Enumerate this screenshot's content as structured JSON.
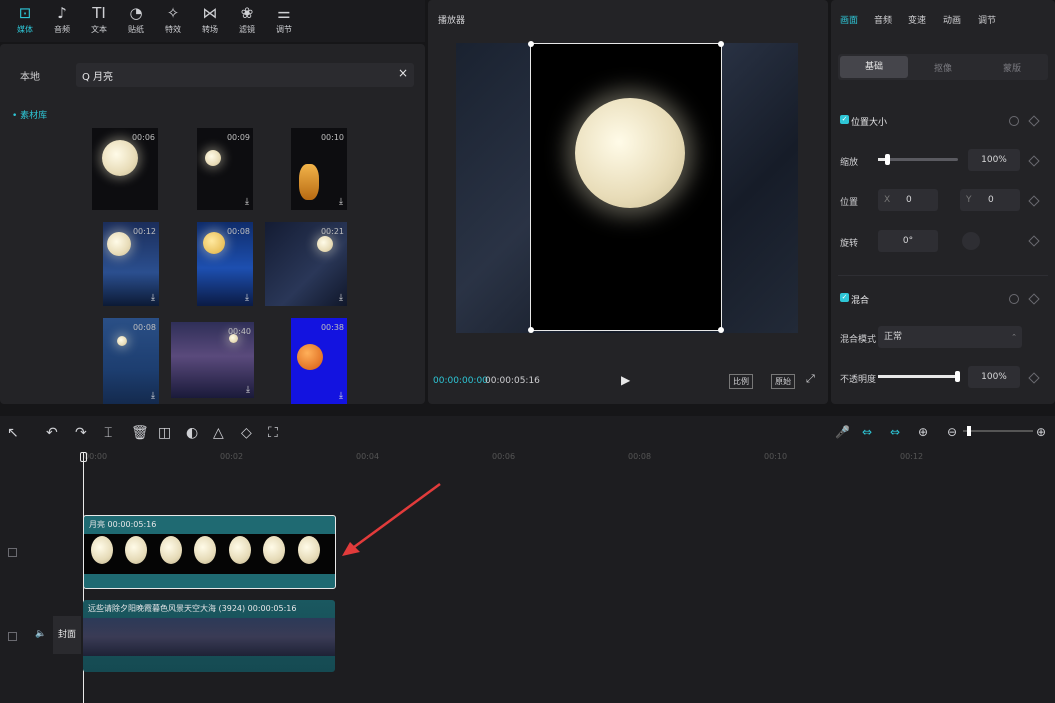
{
  "toolbar": {
    "items": [
      {
        "label": "媒体",
        "icon": "play-square-icon",
        "glyph": "⊡"
      },
      {
        "label": "音频",
        "icon": "music-note-icon",
        "glyph": "♪"
      },
      {
        "label": "文本",
        "icon": "text-icon",
        "glyph": "TI"
      },
      {
        "label": "贴纸",
        "icon": "sticker-icon",
        "glyph": "◔"
      },
      {
        "label": "特效",
        "icon": "sparkle-icon",
        "glyph": "✧"
      },
      {
        "label": "转场",
        "icon": "transition-icon",
        "glyph": "⋈"
      },
      {
        "label": "滤镜",
        "icon": "filter-icon",
        "glyph": "❀"
      },
      {
        "label": "调节",
        "icon": "sliders-icon",
        "glyph": "⚌"
      }
    ]
  },
  "media": {
    "side_local": "本地",
    "side_library": "• 素材库",
    "search_value": "Q 月亮",
    "search_clear": "×",
    "durations": [
      "00:06",
      "00:09",
      "00:10",
      "00:12",
      "00:08",
      "00:21",
      "00:08",
      "00:40",
      "00:38"
    ],
    "download_glyph": "⤓"
  },
  "player": {
    "title": "播放器",
    "time_current": "00:00:00:00",
    "time_total": "00:00:05:16",
    "play_glyph": "▶",
    "ratio_button": "比例",
    "original_button": "原始",
    "fullscreen_glyph": "⤢"
  },
  "inspector": {
    "tabs": [
      "画面",
      "音频",
      "变速",
      "动画",
      "调节"
    ],
    "subtabs": [
      "基础",
      "抠像",
      "蒙版"
    ],
    "position_size": "位置大小",
    "scale_label": "缩放",
    "scale_value": "100%",
    "scale_fraction": 0.12,
    "position_label": "位置",
    "pos_x_label": "X",
    "pos_x_value": "0",
    "pos_y_label": "Y",
    "pos_y_value": "0",
    "rotate_label": "旋转",
    "rotate_value": "0°",
    "blend_title": "混合",
    "blend_mode_label": "混合模式",
    "blend_mode_value": "正常",
    "opacity_label": "不透明度",
    "opacity_value": "100%",
    "opacity_fraction": 1.0
  },
  "timeline": {
    "tools": [
      "↖",
      "↶",
      "↷",
      "⌶",
      "🗑",
      "◫",
      "◐",
      "△",
      "◇",
      "⛶"
    ],
    "tool_names": [
      "select-icon",
      "undo-icon",
      "redo-icon",
      "split-icon",
      "delete-icon",
      "freeze-icon",
      "reverse-icon",
      "mirror-icon",
      "rotate-icon",
      "crop-icon"
    ],
    "right_tools": [
      "🎤",
      "⇔",
      "⇔",
      "⊕",
      "⊖",
      "⊕"
    ],
    "ticks": [
      "00:00",
      "00:02",
      "00:04",
      "00:06",
      "00:08",
      "00:10",
      "00:12"
    ],
    "clip1_label": "月亮   00:00:05:16",
    "clip2_label": "远些请除夕阳晚霞暮色风景天空大海 (3924)   00:00:05:16",
    "cover_label": "封面"
  }
}
